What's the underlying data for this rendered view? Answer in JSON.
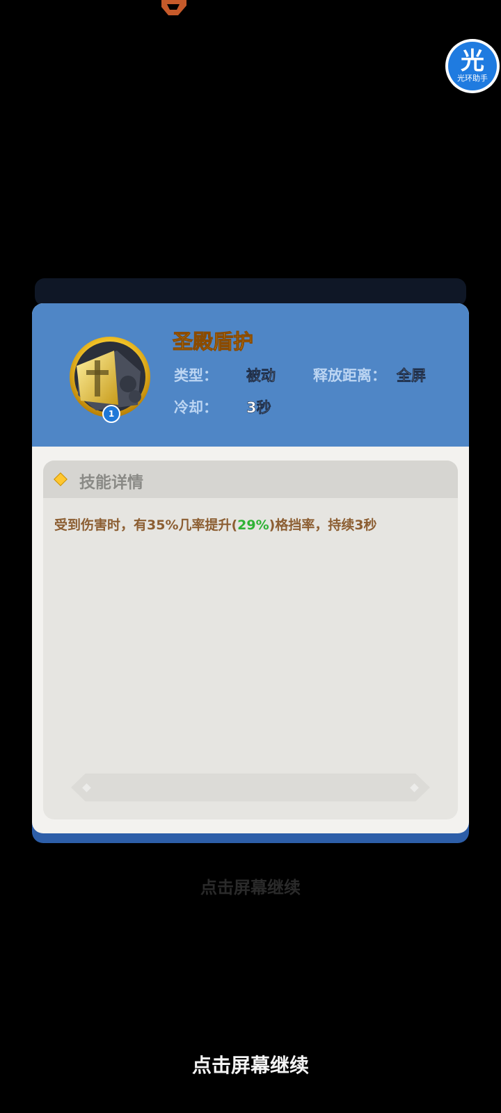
{
  "assistant": {
    "glyph": "光",
    "label": "光环助手"
  },
  "skill": {
    "name": "圣殿盾护",
    "level": "1",
    "type_label": "类型：",
    "type_value": "被动",
    "range_label": "释放距离：",
    "range_value": "全屏",
    "cooldown_label": "冷却：",
    "cooldown_value": "3秒"
  },
  "details": {
    "title": "技能详情",
    "desc_before": "受到伤害时，有35%几率提升(",
    "desc_highlight": "29%",
    "desc_after": ")格挡率，持续3秒"
  },
  "continue_text": "点击屏幕继续",
  "colors": {
    "header_blue": "#4f86c6",
    "skill_name_gold": "#ffcc55",
    "highlight_green": "#2fb235",
    "desc_brown": "#8c5e32"
  }
}
